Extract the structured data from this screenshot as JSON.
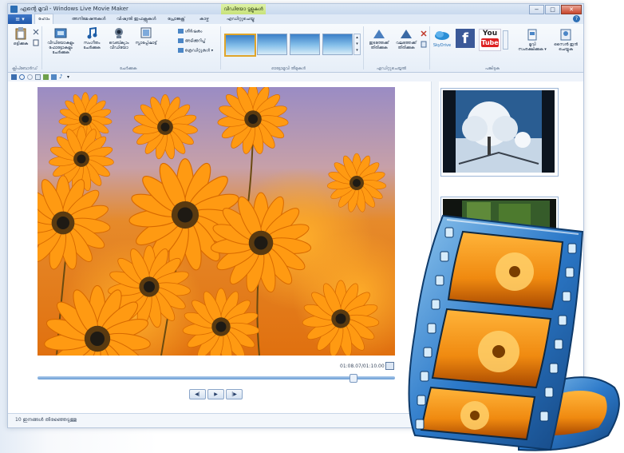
{
  "window": {
    "title_prefix": "എന്റെ മൂവി",
    "title_app": "Windows Live Movie Maker",
    "context_tab_group": "വീഡിയോ ടൂളുകൾ",
    "minimize": "−",
    "maximize": "□",
    "close": "✕"
  },
  "tabs": {
    "file": "≡ ▾",
    "home": "ഹോം",
    "animations": "അനിമേഷനുകൾ",
    "visual_effects": "വിഷ്വൽ ഇഫക്റ്റുകൾ",
    "project": "പ്രോജക്റ്റ്",
    "view": "കാഴ്ച",
    "edit": "എഡിറ്റുചെയ്യൂ",
    "help": "?"
  },
  "ribbon": {
    "paste": "ഒട്ടിക്കുക",
    "clipboard_group": "ക്ലിപ്ബോർഡ്",
    "add_videos_photos": "വീഡിയോകളും ഫോട്ടോകളും ചേർക്കുക",
    "add_music": "സംഗീതം ചേർക്കുക",
    "webcam_video": "വെബ്ക്യാം വീഡിയോ",
    "snapshot": "സ്നാപ്പ്ഷോട്ട്",
    "title": "ശീർഷകം",
    "caption": "അടിക്കുറിപ്പ്",
    "credits": "ക്രെഡിറ്റുകൾ ▾",
    "add_group": "ചേർക്കുക",
    "automovie_group": "ഓട്ടോമൂവി തീമുകൾ",
    "rotate_left": "ഇടത്തേക്ക് തിരിക്കുക",
    "rotate_right": "വലത്തേക്ക് തിരിക്കുക",
    "editing_group": "എഡിറ്റുചെയ്യൽ",
    "skydrive": "SkyDrive",
    "facebook": "f",
    "youtube_top": "You",
    "youtube_bottom": "Tube",
    "save_movie": "മൂവി സംരക്ഷിക്കുക ▾",
    "sign_in": "സൈൻ ഇൻ ചെയ്യുക",
    "share_group": "പങ്കിടുക"
  },
  "preview": {
    "timecode": "01:08.07/01:10.00",
    "prev_frame": "◀|",
    "play": "▶",
    "next_frame": "|▶"
  },
  "status": {
    "selection": "10 ഇനങ്ങൾ തിരഞ്ഞെടുത്തു"
  },
  "colors": {
    "accent": "#2d6fb5",
    "ribbon": "#e6eef8",
    "film_blue": "#2c79c9",
    "flower_orange": "#f08a10"
  }
}
